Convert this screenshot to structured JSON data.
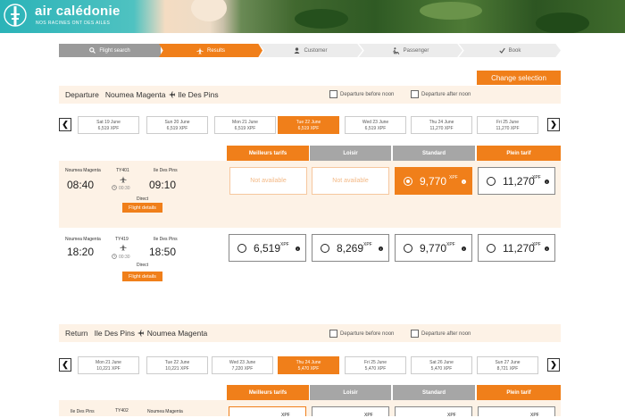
{
  "header": {
    "logo_text": "air calédonie",
    "tagline": "NOS RACINES ONT DES AILES"
  },
  "steps": [
    {
      "label": "Flight search",
      "icon": "search-icon",
      "state": "done"
    },
    {
      "label": "Results",
      "icon": "plane-icon",
      "state": "active"
    },
    {
      "label": "Customer",
      "icon": "user-icon",
      "state": "todo"
    },
    {
      "label": "Passenger",
      "icon": "seat-icon",
      "state": "todo"
    },
    {
      "label": "Book",
      "icon": "check-icon",
      "state": "todo"
    }
  ],
  "change_selection": "Change selection",
  "departure": {
    "label": "Departure",
    "from": "Noumea Magenta",
    "to": "Ile Des Pins",
    "before_noon": "Departure before noon",
    "after_noon": "Departure after noon",
    "dates": [
      {
        "day": "Sat 19 June",
        "price": "6,519 XPF"
      },
      {
        "day": "Sun 20 June",
        "price": "6,519 XPF"
      },
      {
        "day": "Mon 21 June",
        "price": "6,519 XPF"
      },
      {
        "day": "Tue 22 June",
        "price": "6,519 XPF",
        "selected": true
      },
      {
        "day": "Wed 23 June",
        "price": "6,519 XPF"
      },
      {
        "day": "Thu 24 June",
        "price": "11,270 XPF"
      },
      {
        "day": "Fri 25 June",
        "price": "11,270 XPF"
      }
    ],
    "fare_columns": [
      "Meilleurs tarifs",
      "Loisir",
      "Standard",
      "Plein tarif"
    ],
    "flights": [
      {
        "from": "Noumea Magenta",
        "to": "Ile Des Pins",
        "dep": "08:40",
        "arr": "09:10",
        "flight": "TY401",
        "duration": "00:30",
        "type": "Direct",
        "details": "Flight details",
        "fares": [
          {
            "status": "Not available"
          },
          {
            "status": "Not available"
          },
          {
            "amount": "9,770",
            "currency": "XPF",
            "selected": true
          },
          {
            "amount": "11,270",
            "currency": "XPF"
          }
        ]
      },
      {
        "from": "Noumea Magenta",
        "to": "Ile Des Pins",
        "dep": "18:20",
        "arr": "18:50",
        "flight": "TY419",
        "duration": "00:30",
        "type": "Direct",
        "details": "Flight details",
        "fares": [
          {
            "amount": "6,519",
            "currency": "XPF"
          },
          {
            "amount": "8,269",
            "currency": "XPF"
          },
          {
            "amount": "9,770",
            "currency": "XPF"
          },
          {
            "amount": "11,270",
            "currency": "XPF"
          }
        ]
      }
    ]
  },
  "return": {
    "label": "Return",
    "from": "Ile Des Pins",
    "to": "Noumea Magenta",
    "before_noon": "Departure before noon",
    "after_noon": "Departure after noon",
    "dates": [
      {
        "day": "Mon 21 June",
        "price": "10,221 XPF"
      },
      {
        "day": "Tue 22 June",
        "price": "10,221 XPF"
      },
      {
        "day": "Wed 23 June",
        "price": "7,220 XPF"
      },
      {
        "day": "Thu 24 June",
        "price": "5,470 XPF",
        "selected": true
      },
      {
        "day": "Fri 25 June",
        "price": "5,470 XPF"
      },
      {
        "day": "Sat 26 June",
        "price": "5,470 XPF"
      },
      {
        "day": "Sun 27 June",
        "price": "8,721 XPF"
      }
    ],
    "fare_columns": [
      "Meilleurs tarifs",
      "Loisir",
      "Standard",
      "Plein tarif"
    ],
    "flights": [
      {
        "from": "Ile Des Pins",
        "to": "Noumea Magenta",
        "flight": "TY402",
        "currency": "XPF"
      }
    ]
  },
  "colors": {
    "accent": "#f07f1a",
    "grey": "#a6a6a6",
    "highlight": "#fdf2e6"
  }
}
